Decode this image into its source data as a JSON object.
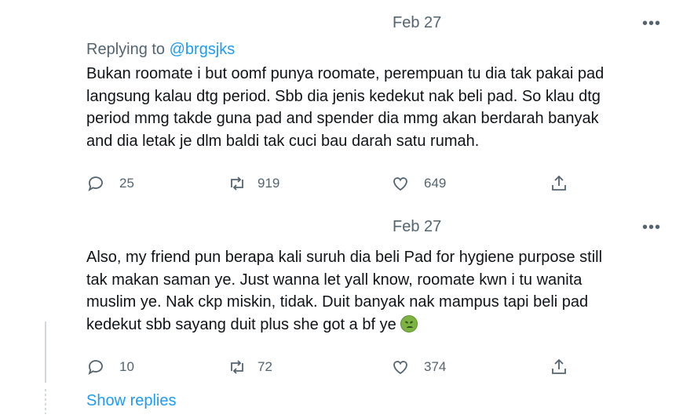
{
  "tweets": [
    {
      "date": "Feb 27",
      "more": "•••",
      "replying_prefix": "Replying to",
      "replying_handle": "@brgsjks",
      "lines": [
        "Bukan roomate i but oomf punya roomate, perempuan tu dia tak pakai pad",
        "langsung kalau dtg period. Sbb dia jenis kedekut nak beli pad. So klau dtg",
        "period mmg takde guna pad and spender dia mmg akan berdarah banyak",
        "and dia letak je dlm baldi tak cuci bau darah satu rumah."
      ],
      "replies": "25",
      "retweets": "919",
      "likes": "649"
    },
    {
      "date": "Feb 27",
      "more": "•••",
      "lines": [
        "Also, my friend pun berapa kali suruh dia beli Pad for hygiene purpose still",
        "tak makan saman ye. Just wanna let yall know, roomate kwn i tu wanita",
        "muslim ye. Nak ckp miskin, tidak. Duit banyak nak mampus tapi beli pad",
        "kedekut sbb sayang duit plus she got a bf ye"
      ],
      "emoji": "nauseated-face",
      "replies": "10",
      "retweets": "72",
      "likes": "374"
    }
  ],
  "show_replies": "Show replies",
  "colors": {
    "text": "#0f1419",
    "muted": "#536471",
    "link": "#1d9bf0",
    "thread_line": "#cfd9de"
  }
}
